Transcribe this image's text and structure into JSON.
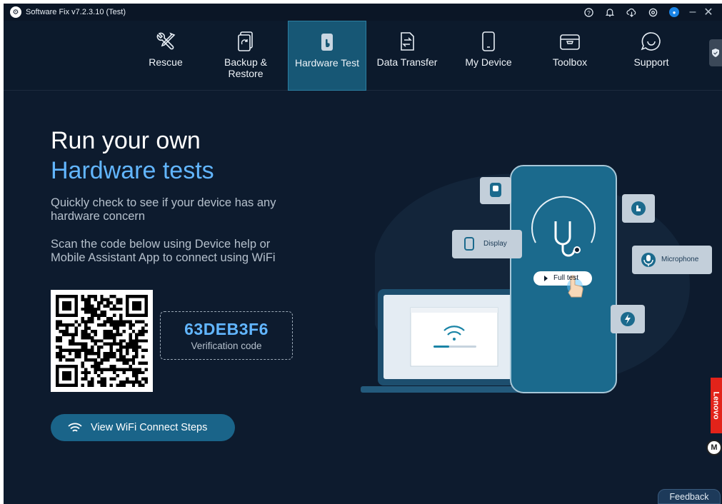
{
  "titlebar": {
    "title": "Software Fix v7.2.3.10 (Test)",
    "icons": [
      "help-icon",
      "bell-icon",
      "cloud-download-icon",
      "settings-icon",
      "user-icon"
    ],
    "minimize": "–",
    "close": "✕"
  },
  "nav": {
    "items": [
      {
        "label": "Rescue",
        "icon": "tools-icon"
      },
      {
        "label": "Backup &\nRestore",
        "icon": "backup-icon"
      },
      {
        "label": "Hardware Test",
        "icon": "touch-device-icon",
        "active": true
      },
      {
        "label": "Data Transfer",
        "icon": "transfer-icon"
      },
      {
        "label": "My Device",
        "icon": "phone-icon"
      },
      {
        "label": "Toolbox",
        "icon": "toolbox-icon"
      },
      {
        "label": "Support",
        "icon": "chat-icon"
      }
    ]
  },
  "main": {
    "title_line1": "Run your own",
    "title_line2": "Hardware tests",
    "desc1": "Quickly check to see if your device has any hardware concern",
    "desc2": "Scan the code below using Device help or Mobile Assistant App to connect using WiFi",
    "verification_code": "63DEB3F6",
    "verification_label": "Verification code",
    "wifi_button": "View WiFi Connect Steps"
  },
  "illustration": {
    "display_label": "Display",
    "microphone_label": "Microphone",
    "full_test_label": "Full test"
  },
  "side": {
    "lenovo": "Lenovo",
    "moto": "M"
  },
  "feedback": "Feedback",
  "colors": {
    "background": "#0d1b2e",
    "accent": "#62b6ff",
    "active_tab": "#175775",
    "button": "#1a6489",
    "lenovo_red": "#e2231a"
  }
}
